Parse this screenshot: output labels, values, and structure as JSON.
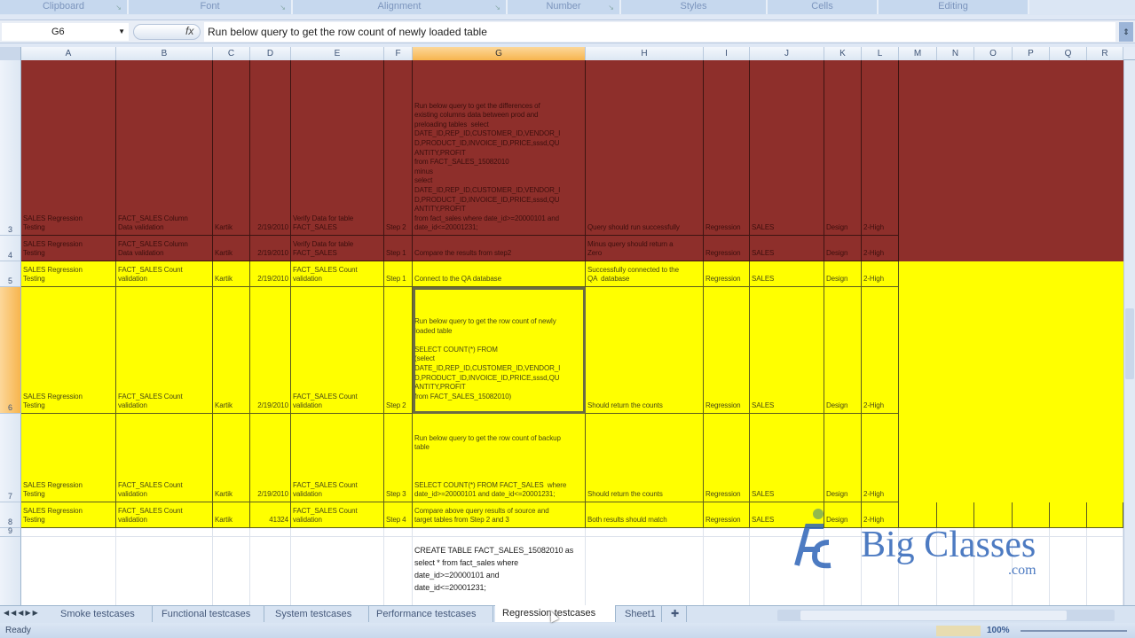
{
  "ribbon": {
    "groups": [
      "Clipboard",
      "Font",
      "Alignment",
      "Number",
      "Styles",
      "Cells",
      "Editing"
    ]
  },
  "formula_bar": {
    "name_box": "G6",
    "fx_icon": "fx",
    "formula": "Run below query to get the row count of newly loaded table"
  },
  "columns": [
    "A",
    "B",
    "C",
    "D",
    "E",
    "F",
    "G",
    "H",
    "I",
    "J",
    "K",
    "L",
    "M",
    "N",
    "O",
    "P",
    "Q",
    "R"
  ],
  "selected_column": "G",
  "selected_row": "6",
  "rows": [
    {
      "num": "3",
      "fill": "maroon",
      "cells": [
        "SALES Regression\nTesting",
        "FACT_SALES Column\nData validation",
        "Kartik",
        "2/19/2010",
        "Verify Data for table\nFACT_SALES",
        "Step 2",
        "Run below query to get the differences of\nexisting columns data between prod and\npreloading tables  select\nDATE_ID,REP_ID,CUSTOMER_ID,VENDOR_I\nD,PRODUCT_ID,INVOICE_ID,PRICE,sssd,QU\nANTITY,PROFIT\nfrom FACT_SALES_15082010\nminus\nselect\nDATE_ID,REP_ID,CUSTOMER_ID,VENDOR_I\nD,PRODUCT_ID,INVOICE_ID,PRICE,sssd,QU\nANTITY,PROFIT\nfrom fact_sales where date_id>=20000101 and\ndate_id<=20001231;",
        "Query should run successfully",
        "Regression",
        "SALES",
        "Design",
        "2-High"
      ]
    },
    {
      "num": "4",
      "fill": "maroon",
      "cells": [
        "SALES Regression\nTesting",
        "FACT_SALES Column\nData validation",
        "Kartik",
        "2/19/2010",
        "Verify Data for table\nFACT_SALES",
        "Step 1",
        "Compare the results from step2",
        "Minus query should return a\nZero",
        "Regression",
        "SALES",
        "Design",
        "2-High"
      ]
    },
    {
      "num": "5",
      "fill": "yellow",
      "cells": [
        "SALES Regression\nTesting",
        "FACT_SALES Count\nvalidation",
        "Kartik",
        "2/19/2010",
        "FACT_SALES Count\nvalidation",
        "Step 1",
        "Connect to the QA database",
        "Successfully connected to the\nQA  database",
        "Regression",
        "SALES",
        "Design",
        "2-High"
      ]
    },
    {
      "num": "6",
      "fill": "yellow",
      "cells": [
        "SALES Regression\nTesting",
        "FACT_SALES Count\nvalidation",
        "Kartik",
        "2/19/2010",
        "FACT_SALES Count\nvalidation",
        "Step 2",
        "Run below query to get the row count of newly\nloaded table\n\nSELECT COUNT(*) FROM\n(select\nDATE_ID,REP_ID,CUSTOMER_ID,VENDOR_I\nD,PRODUCT_ID,INVOICE_ID,PRICE,sssd,QU\nANTITY,PROFIT\nfrom FACT_SALES_15082010)\n\n",
        "Should return the counts",
        "Regression",
        "SALES",
        "Design",
        "2-High"
      ]
    },
    {
      "num": "7",
      "fill": "yellow",
      "cells": [
        "SALES Regression\nTesting",
        "FACT_SALES Count\nvalidation",
        "Kartik",
        "2/19/2010",
        "FACT_SALES Count\nvalidation",
        "Step 3",
        "Run below query to get the row count of backup\ntable\n\n\n\nSELECT COUNT(*) FROM FACT_SALES  where\ndate_id>=20000101 and date_id<=20001231;",
        "Should return the counts",
        "Regression",
        "SALES",
        "Design",
        "2-High"
      ]
    },
    {
      "num": "8",
      "fill": "yellow",
      "cells": [
        "SALES Regression\nTesting",
        "FACT_SALES Count\nvalidation",
        "Kartik",
        "41324",
        "FACT_SALES Count\nvalidation",
        "Step 4",
        "Compare above query results of source and\ntarget tables from Step 2 and 3",
        "Both results should match",
        "Regression",
        "SALES",
        "Design",
        "2-High"
      ]
    },
    {
      "num": "9",
      "fill": "white",
      "cells": [
        "",
        "",
        "",
        "",
        "",
        "",
        "",
        "",
        "",
        "",
        "",
        ""
      ]
    },
    {
      "num": "",
      "fill": "white",
      "cells": [
        "",
        "",
        "",
        "",
        "",
        "",
        "CREATE TABLE FACT_SALES_15082010 as\nselect * from fact_sales where\ndate_id>=20000101 and\ndate_id<=20001231;\n",
        "",
        "",
        "",
        "",
        ""
      ]
    }
  ],
  "sheet_tabs": [
    "Smoke testcases",
    "Functional testcases",
    "System testcases",
    "Performance testcases",
    "Regression testcases",
    "Sheet1"
  ],
  "active_tab": "Regression testcases",
  "status": {
    "text": "Ready",
    "zoom": "100%"
  },
  "watermark": {
    "brand": "Big Classes",
    "suffix": ".com",
    "mark": "BC"
  },
  "colors": {
    "maroon": "#8e2f2b",
    "yellow": "#ffff00",
    "header_selected": "#f7b54e"
  }
}
